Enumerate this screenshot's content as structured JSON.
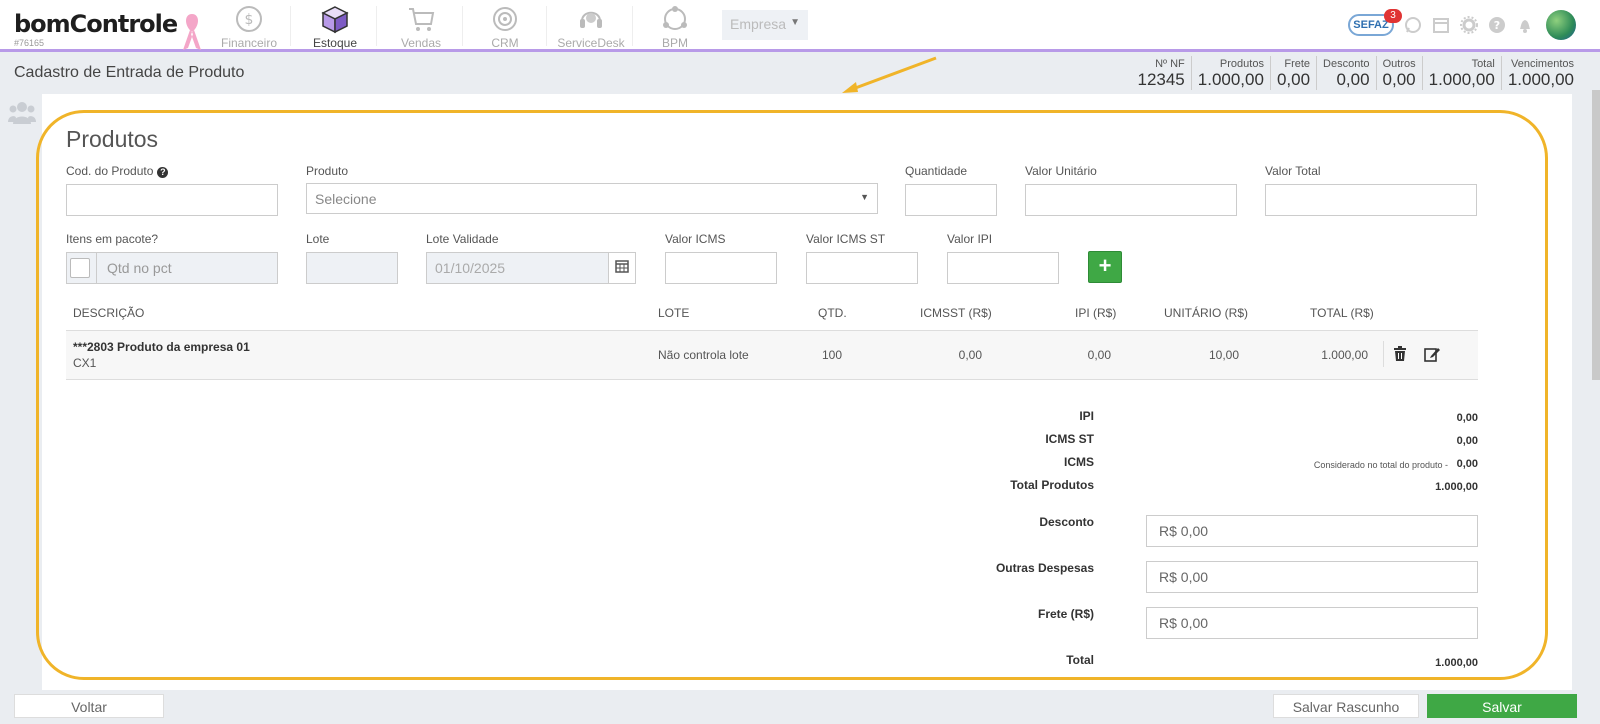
{
  "app": {
    "logo_text": "bomControle",
    "account_id": "#76165"
  },
  "nav": {
    "items": [
      {
        "label": "Financeiro",
        "icon": "dollar-coin-icon"
      },
      {
        "label": "Estoque",
        "icon": "cube-box-icon"
      },
      {
        "label": "Vendas",
        "icon": "shopping-cart-icon"
      },
      {
        "label": "CRM",
        "icon": "target-icon"
      },
      {
        "label": "ServiceDesk",
        "icon": "headset-icon"
      },
      {
        "label": "BPM",
        "icon": "process-flow-icon"
      }
    ],
    "company_select": "Empresa"
  },
  "header_icons": {
    "sefaz_label": "SEFAZ",
    "sefaz_badge": "3"
  },
  "page": {
    "title": "Cadastro de Entrada de Produto"
  },
  "summary": [
    {
      "label": "Nº NF",
      "value": "12345"
    },
    {
      "label": "Produtos",
      "value": "1.000,00"
    },
    {
      "label": "Frete",
      "value": "0,00"
    },
    {
      "label": "Desconto",
      "value": "0,00"
    },
    {
      "label": "Outros",
      "value": "0,00"
    },
    {
      "label": "Total",
      "value": "1.000,00"
    },
    {
      "label": "Vencimentos",
      "value": "1.000,00"
    }
  ],
  "form": {
    "section_title": "Produtos",
    "cod_produto_label": "Cod. do Produto",
    "produto_label": "Produto",
    "produto_placeholder": "Selecione",
    "quantidade_label": "Quantidade",
    "valor_unitario_label": "Valor Unitário",
    "valor_total_label": "Valor Total",
    "itens_pacote_label": "Itens em pacote?",
    "qtd_pct_placeholder": "Qtd no pct",
    "lote_label": "Lote",
    "lote_validade_label": "Lote Validade",
    "lote_validade_value": "01/10/2025",
    "valor_icms_label": "Valor ICMS",
    "valor_icms_st_label": "Valor ICMS ST",
    "valor_ipi_label": "Valor IPI",
    "add_button": "+"
  },
  "table": {
    "headers": [
      "DESCRIÇÃO",
      "LOTE",
      "QTD.",
      "ICMSST (R$)",
      "IPI (R$)",
      "UNITÁRIO (R$)",
      "TOTAL (R$)"
    ],
    "rows": [
      {
        "descricao": "***2803 Produto da empresa 01",
        "unidade": "CX1",
        "lote": "Não controla lote",
        "qtd": "100",
        "icmsst": "0,00",
        "ipi": "0,00",
        "unitario": "10,00",
        "total": "1.000,00"
      }
    ]
  },
  "totals": {
    "ipi_label": "IPI",
    "ipi_value": "0,00",
    "icms_st_label": "ICMS ST",
    "icms_st_value": "0,00",
    "icms_label": "ICMS",
    "icms_note": "Considerado no total do produto -",
    "icms_value": "0,00",
    "total_produtos_label": "Total Produtos",
    "total_produtos_value": "1.000,00",
    "desconto_label": "Desconto",
    "desconto_value": "R$ 0,00",
    "outras_label": "Outras Despesas",
    "outras_value": "R$ 0,00",
    "frete_label": "Frete (R$)",
    "frete_value": "R$ 0,00",
    "total_label": "Total",
    "total_value": "1.000,00"
  },
  "footer": {
    "voltar": "Voltar",
    "salvar_rascunho": "Salvar Rascunho",
    "salvar": "Salvar"
  },
  "colors": {
    "accent_border": "#b89ae8",
    "highlight": "#f0b429",
    "success": "#3fa845"
  }
}
